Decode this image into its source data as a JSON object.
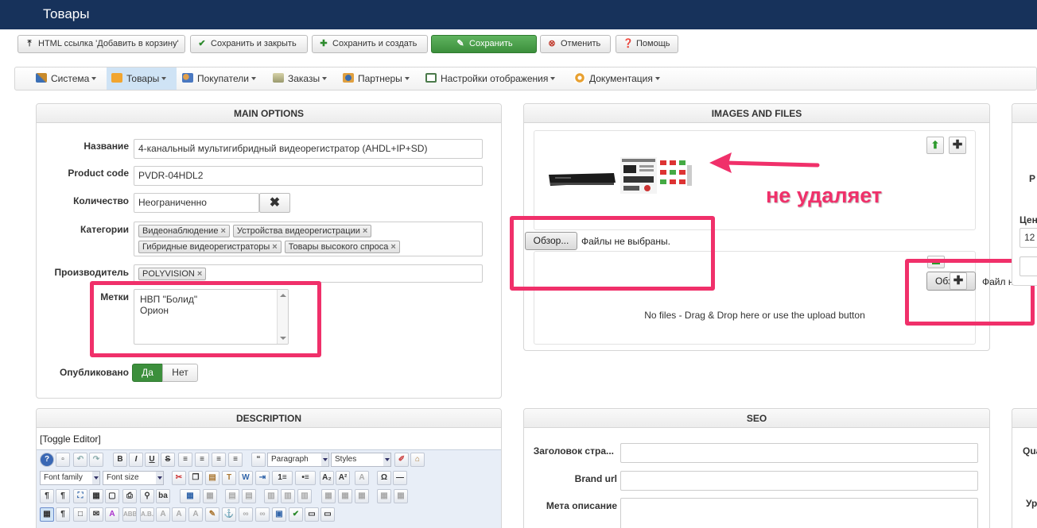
{
  "header": {
    "title": "Товары"
  },
  "toolbar": {
    "html_link_label": "HTML ссылка 'Добавить в корзину'",
    "save_close_label": "Сохранить и закрыть",
    "save_new_label": "Сохранить и создать",
    "save_label": "Сохранить",
    "cancel_label": "Отменить",
    "help_label": "Помощь"
  },
  "menu": {
    "items": [
      {
        "label": "Система",
        "icon": "tools-icon"
      },
      {
        "label": "Товары",
        "icon": "box-icon"
      },
      {
        "label": "Покупатели",
        "icon": "users-icon"
      },
      {
        "label": "Заказы",
        "icon": "orders-icon"
      },
      {
        "label": "Партнеры",
        "icon": "partners-icon"
      },
      {
        "label": "Настройки отображения",
        "icon": "display-icon"
      },
      {
        "label": "Документация",
        "icon": "docs-icon"
      }
    ]
  },
  "main_options": {
    "title": "MAIN OPTIONS",
    "name_label": "Название",
    "name_value": "4-канальный мультигибридный видеорегистратор (AHDL+IP+SD)",
    "code_label": "Product code",
    "code_value": "PVDR-04HDL2",
    "qty_label": "Количество",
    "qty_value": "Неограниченно",
    "cat_label": "Категории",
    "categories": [
      "Видеонаблюдение",
      "Устройства видеорегистрации",
      "Гибридные видеорегистраторы",
      "Товары высокого спроса"
    ],
    "maker_label": "Производитель",
    "maker_value": "POLYVISION",
    "tags_label": "Метки",
    "tags_line1": "НВП \"Болид\"",
    "tags_line2": "Орион",
    "published_label": "Опубликовано",
    "published_yes": "Да",
    "published_no": "Нет"
  },
  "images": {
    "title": "IMAGES AND FILES",
    "browse_label": "Обзор...",
    "no_file_text": "Файлы не выбраны.",
    "drop_text": "No files - Drag & Drop here or use the upload button",
    "annotation": "не удаляет"
  },
  "third_panel": {
    "browse_label": "Обз",
    "file_partial": "Файл н",
    "value_partial": "12",
    "label_partial_1": "Р",
    "label_partial_2": "Цен"
  },
  "description": {
    "title": "DESCRIPTION",
    "toggle_label": "[Toggle Editor]",
    "paragraph_label": "Paragraph",
    "styles_label": "Styles",
    "font_family_label": "Font family",
    "font_size_label": "Font size"
  },
  "seo": {
    "title": "SEO",
    "title_label": "Заголовок стра...",
    "brand_label": "Brand url",
    "meta_label": "Мета описание"
  },
  "fourth_panel": {
    "label_1": "Qua",
    "label_2": "Ур"
  },
  "colors": {
    "header": "#17325b",
    "accent": "#f0306a",
    "success": "#3c8f3c"
  }
}
